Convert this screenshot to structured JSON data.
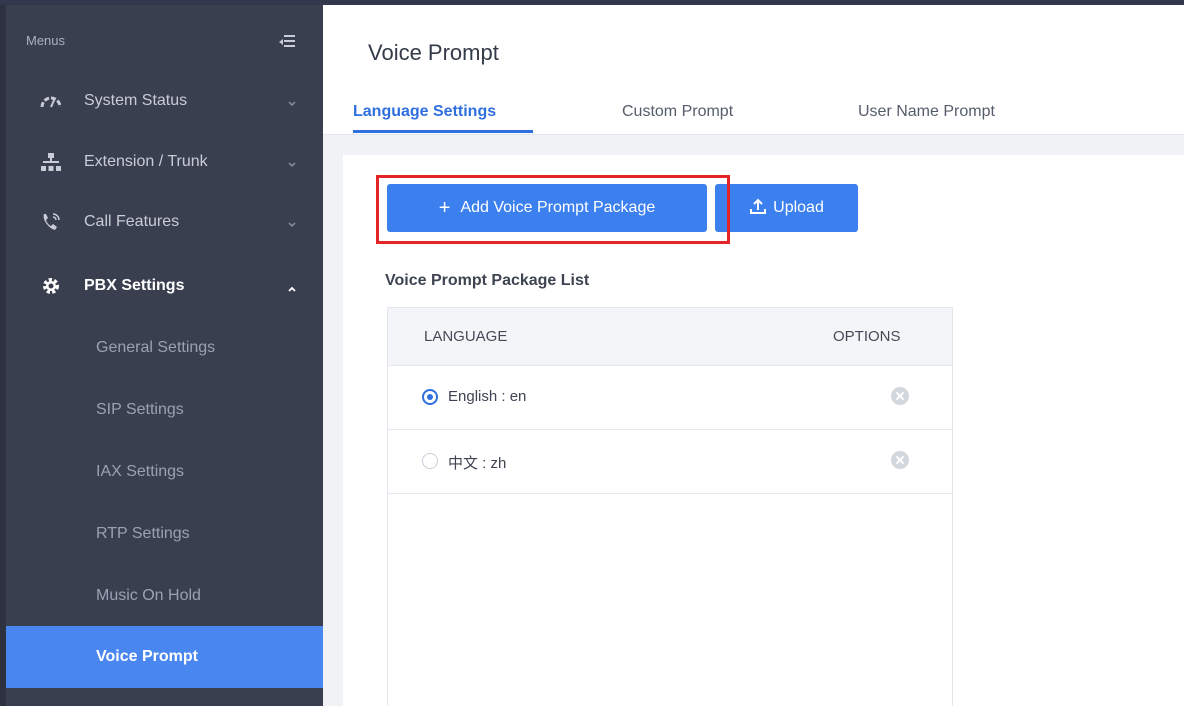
{
  "sidebar": {
    "header": "Menus",
    "items": [
      {
        "label": "System Status",
        "icon": "gauge-icon"
      },
      {
        "label": "Extension / Trunk",
        "icon": "network-icon"
      },
      {
        "label": "Call Features",
        "icon": "phone-icon"
      },
      {
        "label": "PBX Settings",
        "icon": "gear-icon"
      }
    ],
    "sub_items": [
      {
        "label": "General Settings"
      },
      {
        "label": "SIP Settings"
      },
      {
        "label": "IAX Settings"
      },
      {
        "label": "RTP Settings"
      },
      {
        "label": "Music On Hold"
      },
      {
        "label": "Voice Prompt",
        "selected": true
      }
    ]
  },
  "main": {
    "title": "Voice Prompt",
    "tabs": [
      {
        "label": "Language Settings",
        "active": true
      },
      {
        "label": "Custom Prompt"
      },
      {
        "label": "User Name Prompt"
      }
    ]
  },
  "content": {
    "add_button": "Add Voice Prompt Package",
    "upload_button": "Upload",
    "list_title": "Voice Prompt Package List",
    "columns": {
      "language": "LANGUAGE",
      "options": "OPTIONS"
    },
    "rows": [
      {
        "language": "English : en",
        "selected": true
      },
      {
        "language": "中文 : zh",
        "selected": false
      }
    ]
  },
  "colors": {
    "accent": "#3c80f0",
    "sidebar_bg": "#3a3f50",
    "highlight": "#e52525"
  }
}
